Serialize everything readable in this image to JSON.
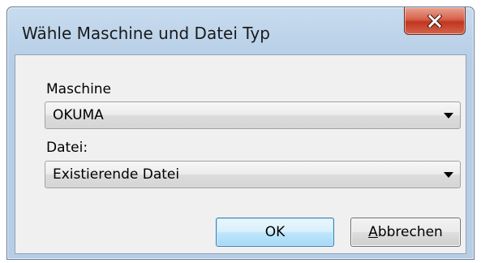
{
  "window": {
    "title": "Wähle Maschine und Datei Typ",
    "close_icon": "close-icon"
  },
  "machine": {
    "label": "Maschine",
    "value": "OKUMA"
  },
  "file": {
    "label": "Datei:",
    "value": "Existierende Datei"
  },
  "buttons": {
    "ok_label": "OK",
    "cancel_accel": "A",
    "cancel_rest": "bbrechen"
  },
  "colors": {
    "close_button": "#c9452e",
    "ok_button_border": "#3c7fb1",
    "client_bg": "#f0f0f0"
  }
}
